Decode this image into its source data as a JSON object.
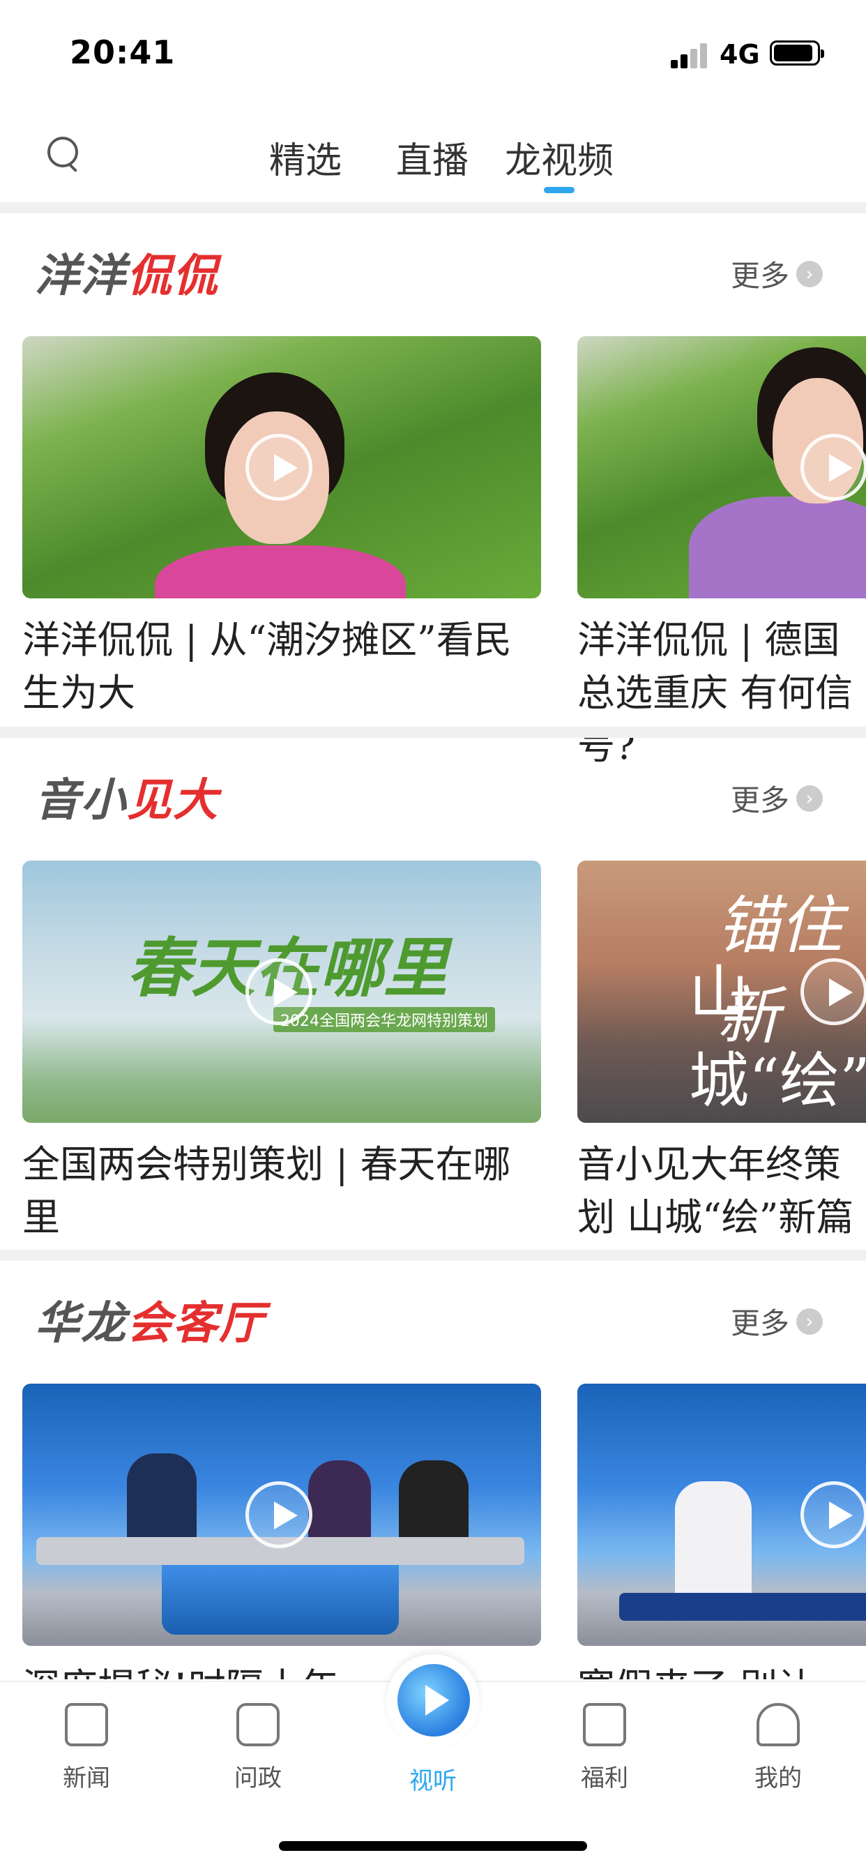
{
  "status": {
    "time": "20:41",
    "network": "4G"
  },
  "topnav": {
    "tabs": [
      {
        "label": "精选"
      },
      {
        "label": "直播"
      },
      {
        "label": "龙视频"
      }
    ],
    "active_tab": "龙视频"
  },
  "sections": [
    {
      "title_dark": "洋洋",
      "title_red": "侃侃",
      "more": "更多",
      "cards": [
        {
          "title": "洋洋侃侃 | 从“潮汐摊区”看民生为大"
        },
        {
          "title": "洋洋侃侃 | 德国总选重庆 有何信号?"
        }
      ]
    },
    {
      "title_dark": "音小",
      "title_red": "见大",
      "more": "更多",
      "cards": [
        {
          "title": "全国两会特别策划 | 春天在哪里",
          "thumb_text": "春天在哪里",
          "thumb_sub": "2024全国两会华龙网特别策划"
        },
        {
          "title": "音小见大年终策划 山城“绘”新篇",
          "thumb_text": "锚住新",
          "thumb_text2": "山城“绘”"
        }
      ]
    },
    {
      "title_dark": "华龙",
      "title_red": "会客厅",
      "more": "更多",
      "cards": [
        {
          "title": "深度揭秘!时隔十年"
        },
        {
          "title": "寒假来了,别让"
        }
      ]
    }
  ],
  "tabbar": {
    "items": [
      {
        "label": "新闻",
        "icon": "news-icon"
      },
      {
        "label": "问政",
        "icon": "chat-icon"
      },
      {
        "label": "视听",
        "icon": "play-icon"
      },
      {
        "label": "福利",
        "icon": "gift-icon"
      },
      {
        "label": "我的",
        "icon": "profile-icon"
      }
    ],
    "active": "视听"
  },
  "colors": {
    "accent": "#2ea6f0",
    "brand_red": "#e52f2f"
  }
}
